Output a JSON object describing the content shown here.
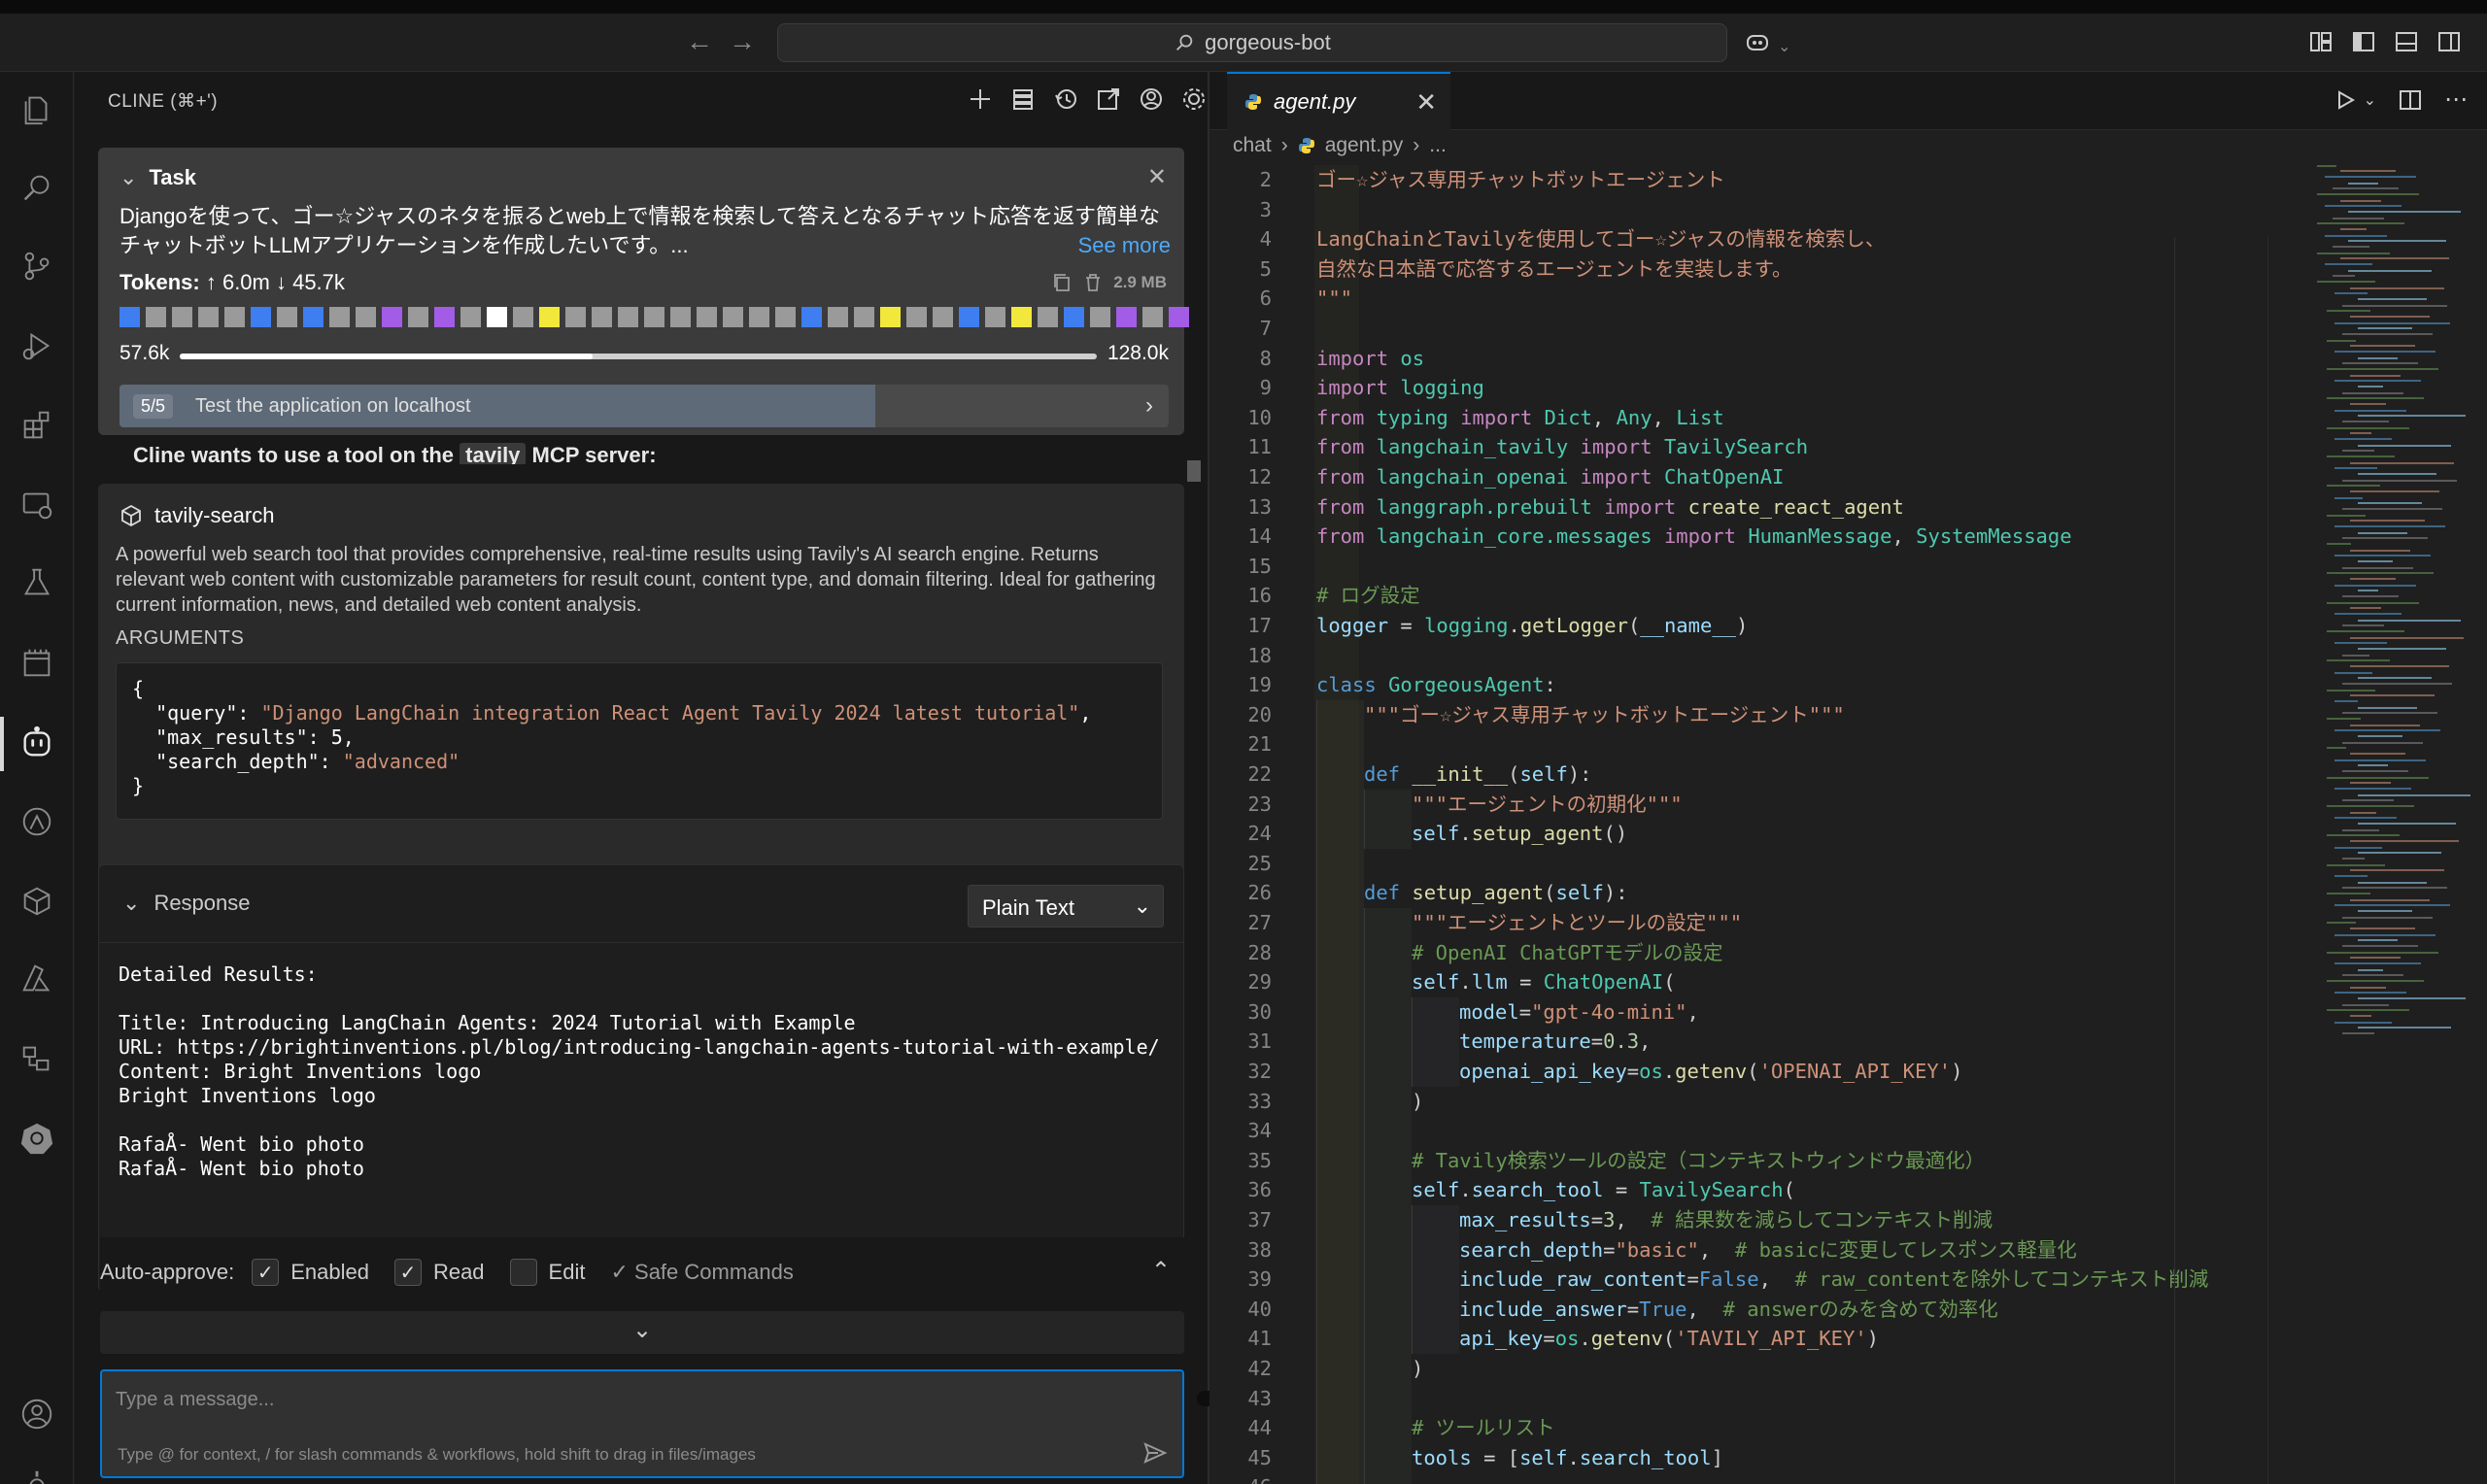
{
  "titlebar": {
    "search_text": "gorgeous-bot"
  },
  "sidebar": {
    "header_title": "CLINE (⌘+')",
    "task": {
      "title": "Task",
      "description": "Djangoを使って、ゴー☆ジャスのネタを振るとweb上で情報を検索して答えとなるチャット応答を返す簡単なチャットボットLLMアプリケーションを作成したいです。...",
      "see_more": "See more",
      "tokens_label": "Tokens:",
      "tokens_values": "↑ 6.0m ↓ 45.7k",
      "size": "2.9 MB",
      "context_used": "57.6k",
      "context_max": "128.0k",
      "context_fraction": 0.45,
      "step_badge": "5/5",
      "step_text": "Test the application on localhost",
      "step_fraction": 0.72,
      "square_colors": [
        "#3e7ef0",
        "#9a9a9a",
        "#9a9a9a",
        "#9a9a9a",
        "#9a9a9a",
        "#3e7ef0",
        "#9a9a9a",
        "#3e7ef0",
        "#9a9a9a",
        "#9a9a9a",
        "#a25ce6",
        "#9a9a9a",
        "#a25ce6",
        "#9a9a9a",
        "#ffffff",
        "#9a9a9a",
        "#f2e83c",
        "#9a9a9a",
        "#9a9a9a",
        "#9a9a9a",
        "#9a9a9a",
        "#9a9a9a",
        "#9a9a9a",
        "#9a9a9a",
        "#9a9a9a",
        "#9a9a9a",
        "#3e7ef0",
        "#9a9a9a",
        "#9a9a9a",
        "#f2e83c",
        "#9a9a9a",
        "#9a9a9a",
        "#3e7ef0",
        "#9a9a9a",
        "#f2e83c",
        "#9a9a9a",
        "#3e7ef0",
        "#9a9a9a",
        "#a25ce6",
        "#9a9a9a",
        "#a25ce6"
      ]
    },
    "cline_wants_prefix": "Cline wants to use a tool on the",
    "cline_wants_server": "tavily",
    "cline_wants_suffix": "MCP server:",
    "tool": {
      "name": "tavily-search",
      "description": "A powerful web search tool that provides comprehensive, real-time results using Tavily's AI search engine. Returns relevant web content with customizable parameters for result count, content type, and domain filtering. Ideal for gathering current information, news, and detailed web content analysis.",
      "arguments_label": "ARGUMENTS",
      "args": {
        "open": "{",
        "query_key": "  \"query\": ",
        "query_val": "\"Django LangChain integration React Agent Tavily 2024 latest tutorial\"",
        "query_end": ",",
        "max_key": "  \"max_results\": 5,",
        "depth_key": "  \"search_depth\": ",
        "depth_val": "\"advanced\"",
        "close": "}"
      }
    },
    "response": {
      "title": "Response",
      "format": "Plain Text",
      "body": "Detailed Results:\n\nTitle: Introducing LangChain Agents: 2024 Tutorial with Example\nURL: https://brightinventions.pl/blog/introducing-langchain-agents-tutorial-with-example/\nContent: Bright Inventions logo\nBright Inventions logo\n\nRafaÅ- Went bio photo\nRafaÅ- Went bio photo"
    },
    "auto_approve": {
      "label": "Auto-approve:",
      "enabled": "Enabled",
      "read": "Read",
      "edit": "Edit",
      "safe_commands": "✓ Safe Commands"
    },
    "input": {
      "placeholder": "Type a message...",
      "hint": "Type @ for context, / for slash commands & workflows, hold shift to drag in files/images"
    }
  },
  "editor": {
    "tab_label": "agent.py",
    "breadcrumb": [
      "chat",
      "agent.py",
      "..."
    ],
    "lines": [
      {
        "n": "2",
        "indent": 0,
        "t": [
          [
            "ゴー☆ジャス専用チャットボットエージェント",
            "str"
          ]
        ]
      },
      {
        "n": "3",
        "indent": 0,
        "t": []
      },
      {
        "n": "4",
        "indent": 0,
        "t": [
          [
            "LangChainとTavilyを使用してゴー☆ジャスの情報を検索し、",
            "str"
          ]
        ]
      },
      {
        "n": "5",
        "indent": 0,
        "t": [
          [
            "自然な日本語で応答するエージェントを実装します。",
            "str"
          ]
        ]
      },
      {
        "n": "6",
        "indent": 0,
        "t": [
          [
            "\"\"\"",
            "str"
          ]
        ]
      },
      {
        "n": "7",
        "indent": 0,
        "t": []
      },
      {
        "n": "8",
        "indent": 0,
        "t": [
          [
            "import ",
            "kw"
          ],
          [
            "os",
            "cls"
          ]
        ]
      },
      {
        "n": "9",
        "indent": 0,
        "t": [
          [
            "import ",
            "kw"
          ],
          [
            "logging",
            "cls"
          ]
        ]
      },
      {
        "n": "10",
        "indent": 0,
        "t": [
          [
            "from ",
            "kw"
          ],
          [
            "typing ",
            "cls"
          ],
          [
            "import ",
            "kw"
          ],
          [
            "Dict",
            "cls"
          ],
          [
            ", ",
            ""
          ],
          [
            "Any",
            "cls"
          ],
          [
            ", ",
            ""
          ],
          [
            "List",
            "cls"
          ]
        ]
      },
      {
        "n": "11",
        "indent": 0,
        "t": [
          [
            "from ",
            "kw"
          ],
          [
            "langchain_tavily ",
            "cls"
          ],
          [
            "import ",
            "kw"
          ],
          [
            "TavilySearch",
            "cls"
          ]
        ]
      },
      {
        "n": "12",
        "indent": 0,
        "t": [
          [
            "from ",
            "kw"
          ],
          [
            "langchain_openai ",
            "cls"
          ],
          [
            "import ",
            "kw"
          ],
          [
            "ChatOpenAI",
            "cls"
          ]
        ]
      },
      {
        "n": "13",
        "indent": 0,
        "t": [
          [
            "from ",
            "kw"
          ],
          [
            "langgraph.prebuilt ",
            "cls"
          ],
          [
            "import ",
            "kw"
          ],
          [
            "create_react_agent",
            "fn"
          ]
        ]
      },
      {
        "n": "14",
        "indent": 0,
        "t": [
          [
            "from ",
            "kw"
          ],
          [
            "langchain_core.messages ",
            "cls"
          ],
          [
            "import ",
            "kw"
          ],
          [
            "HumanMessage",
            "cls"
          ],
          [
            ", ",
            ""
          ],
          [
            "SystemMessage",
            "cls"
          ]
        ]
      },
      {
        "n": "15",
        "indent": 0,
        "t": []
      },
      {
        "n": "16",
        "indent": 0,
        "t": [
          [
            "# ログ設定",
            "cm"
          ]
        ]
      },
      {
        "n": "17",
        "indent": 0,
        "t": [
          [
            "logger ",
            "var"
          ],
          [
            "= ",
            "op"
          ],
          [
            "logging",
            "cls"
          ],
          [
            ".",
            ""
          ],
          [
            "getLogger",
            "fn"
          ],
          [
            "(",
            ""
          ],
          [
            "__name__",
            "var"
          ],
          [
            ")",
            ""
          ]
        ]
      },
      {
        "n": "18",
        "indent": 0,
        "t": []
      },
      {
        "n": "19",
        "indent": 0,
        "t": [
          [
            "class ",
            "kd"
          ],
          [
            "GorgeousAgent",
            "cls"
          ],
          [
            ":",
            ""
          ]
        ]
      },
      {
        "n": "20",
        "indent": 1,
        "t": [
          [
            "\"\"\"ゴー☆ジャス専用チャットボットエージェント\"\"\"",
            "str"
          ]
        ]
      },
      {
        "n": "21",
        "indent": 1,
        "t": []
      },
      {
        "n": "22",
        "indent": 1,
        "t": [
          [
            "def ",
            "kd"
          ],
          [
            "__init__",
            "fn"
          ],
          [
            "(",
            ""
          ],
          [
            "self",
            "var"
          ],
          [
            "):",
            ""
          ]
        ]
      },
      {
        "n": "23",
        "indent": 2,
        "t": [
          [
            "\"\"\"エージェントの初期化\"\"\"",
            "str"
          ]
        ]
      },
      {
        "n": "24",
        "indent": 2,
        "t": [
          [
            "self",
            "var"
          ],
          [
            ".",
            ""
          ],
          [
            "setup_agent",
            "fn"
          ],
          [
            "()",
            ""
          ]
        ]
      },
      {
        "n": "25",
        "indent": 1,
        "t": []
      },
      {
        "n": "26",
        "indent": 1,
        "t": [
          [
            "def ",
            "kd"
          ],
          [
            "setup_agent",
            "fn"
          ],
          [
            "(",
            ""
          ],
          [
            "self",
            "var"
          ],
          [
            "):",
            ""
          ]
        ]
      },
      {
        "n": "27",
        "indent": 2,
        "t": [
          [
            "\"\"\"エージェントとツールの設定\"\"\"",
            "str"
          ]
        ]
      },
      {
        "n": "28",
        "indent": 2,
        "t": [
          [
            "# OpenAI ChatGPTモデルの設定",
            "cm"
          ]
        ]
      },
      {
        "n": "29",
        "indent": 2,
        "t": [
          [
            "self",
            "var"
          ],
          [
            ".",
            ""
          ],
          [
            "llm ",
            "var"
          ],
          [
            "= ",
            "op"
          ],
          [
            "ChatOpenAI",
            "cls"
          ],
          [
            "(",
            ""
          ]
        ]
      },
      {
        "n": "30",
        "indent": 3,
        "t": [
          [
            "model",
            "var"
          ],
          [
            "=",
            ""
          ],
          [
            "\"gpt-4o-mini\"",
            "str"
          ],
          [
            ",",
            ""
          ]
        ]
      },
      {
        "n": "31",
        "indent": 3,
        "t": [
          [
            "temperature",
            "var"
          ],
          [
            "=",
            ""
          ],
          [
            "0.3",
            "num"
          ],
          [
            ",",
            ""
          ]
        ]
      },
      {
        "n": "32",
        "indent": 3,
        "t": [
          [
            "openai_api_key",
            "var"
          ],
          [
            "=",
            ""
          ],
          [
            "os",
            "cls"
          ],
          [
            ".",
            ""
          ],
          [
            "getenv",
            "fn"
          ],
          [
            "(",
            ""
          ],
          [
            "'OPENAI_API_KEY'",
            "str"
          ],
          [
            ")",
            ""
          ]
        ]
      },
      {
        "n": "33",
        "indent": 2,
        "t": [
          [
            ")",
            ""
          ]
        ]
      },
      {
        "n": "34",
        "indent": 2,
        "t": []
      },
      {
        "n": "35",
        "indent": 2,
        "t": [
          [
            "# Tavily検索ツールの設定（コンテキストウィンドウ最適化）",
            "cm"
          ]
        ]
      },
      {
        "n": "36",
        "indent": 2,
        "t": [
          [
            "self",
            "var"
          ],
          [
            ".",
            ""
          ],
          [
            "search_tool ",
            "var"
          ],
          [
            "= ",
            "op"
          ],
          [
            "TavilySearch",
            "cls"
          ],
          [
            "(",
            ""
          ]
        ]
      },
      {
        "n": "37",
        "indent": 3,
        "t": [
          [
            "max_results",
            "var"
          ],
          [
            "=",
            ""
          ],
          [
            "3",
            "num"
          ],
          [
            ",  ",
            ""
          ],
          [
            "# 結果数を減らしてコンテキスト削減",
            "cm"
          ]
        ]
      },
      {
        "n": "38",
        "indent": 3,
        "t": [
          [
            "search_depth",
            "var"
          ],
          [
            "=",
            ""
          ],
          [
            "\"basic\"",
            "str"
          ],
          [
            ",  ",
            ""
          ],
          [
            "# basicに変更してレスポンス軽量化",
            "cm"
          ]
        ]
      },
      {
        "n": "39",
        "indent": 3,
        "t": [
          [
            "include_raw_content",
            "var"
          ],
          [
            "=",
            ""
          ],
          [
            "False",
            "kd"
          ],
          [
            ",  ",
            ""
          ],
          [
            "# raw_contentを除外してコンテキスト削減",
            "cm"
          ]
        ]
      },
      {
        "n": "40",
        "indent": 3,
        "t": [
          [
            "include_answer",
            "var"
          ],
          [
            "=",
            ""
          ],
          [
            "True",
            "kd"
          ],
          [
            ",  ",
            ""
          ],
          [
            "# answerのみを含めて効率化",
            "cm"
          ]
        ]
      },
      {
        "n": "41",
        "indent": 3,
        "t": [
          [
            "api_key",
            "var"
          ],
          [
            "=",
            ""
          ],
          [
            "os",
            "cls"
          ],
          [
            ".",
            ""
          ],
          [
            "getenv",
            "fn"
          ],
          [
            "(",
            ""
          ],
          [
            "'TAVILY_API_KEY'",
            "str"
          ],
          [
            ")",
            ""
          ]
        ]
      },
      {
        "n": "42",
        "indent": 2,
        "t": [
          [
            ")",
            ""
          ]
        ]
      },
      {
        "n": "43",
        "indent": 2,
        "t": []
      },
      {
        "n": "44",
        "indent": 2,
        "t": [
          [
            "# ツールリスト",
            "cm"
          ]
        ]
      },
      {
        "n": "45",
        "indent": 2,
        "t": [
          [
            "tools ",
            "var"
          ],
          [
            "= ",
            "op"
          ],
          [
            "[",
            ""
          ],
          [
            "self",
            "var"
          ],
          [
            ".",
            ""
          ],
          [
            "search_tool",
            "var"
          ],
          [
            "]",
            ""
          ]
        ]
      },
      {
        "n": "46",
        "indent": 2,
        "t": []
      }
    ]
  }
}
